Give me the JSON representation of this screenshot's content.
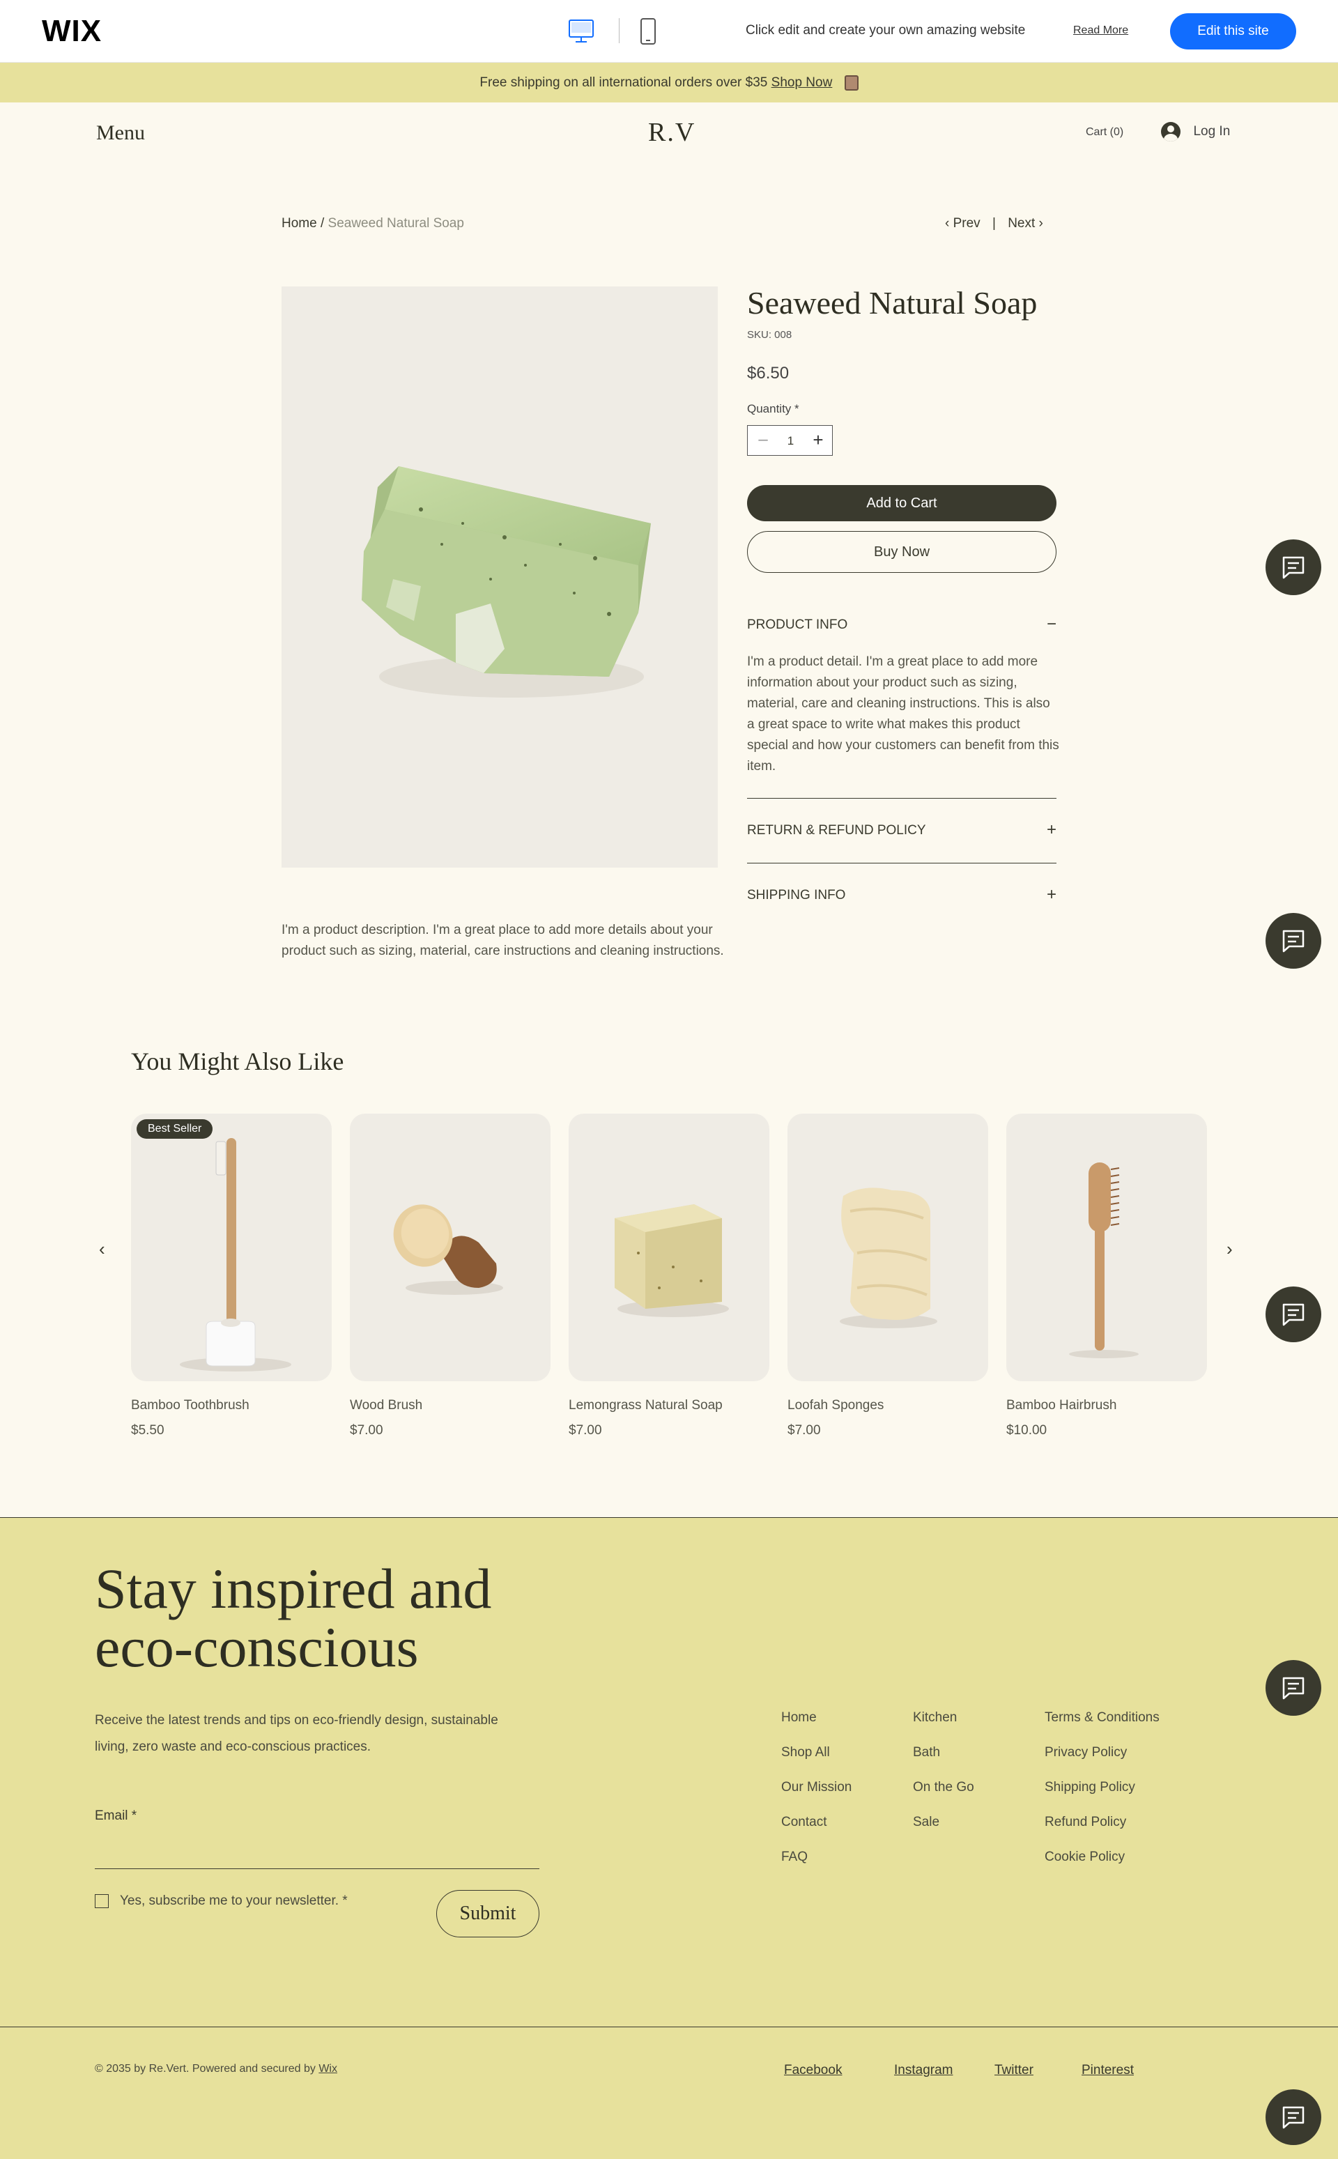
{
  "wix_bar": {
    "logo": "WIX",
    "promo_text": "Click edit and create your own amazing website",
    "read_more": "Read More",
    "edit_button": "Edit this site",
    "accent_color": "#116dff"
  },
  "announcement": {
    "text": "Free shipping on all international orders over $35",
    "link": "Shop Now",
    "icon": "shopping-bag-icon"
  },
  "header": {
    "menu": "Menu",
    "logo": "R.V",
    "cart": "Cart (0)",
    "login": "Log In"
  },
  "breadcrumb": {
    "home": "Home",
    "separator": " / ",
    "current": "Seaweed Natural Soap",
    "prev": "Prev",
    "divider": "|",
    "next": "Next"
  },
  "product": {
    "title": "Seaweed Natural Soap",
    "sku": "SKU: 008",
    "price": "$6.50",
    "quantity_label": "Quantity *",
    "quantity_value": "1",
    "add_to_cart": "Add to Cart",
    "buy_now": "Buy Now",
    "description": "I'm a product description. I'm a great place to add more details about your product such as sizing, material, care instructions and cleaning instructions.",
    "accordion": [
      {
        "title": "PRODUCT INFO",
        "toggle": "−",
        "body": "I'm a product detail. I'm a great place to add more information about your product such as sizing, material, care and cleaning instructions. This is also a great space to write what makes this product special and how your customers can benefit from this item."
      },
      {
        "title": "RETURN & REFUND POLICY",
        "toggle": "+"
      },
      {
        "title": "SHIPPING INFO",
        "toggle": "+"
      }
    ]
  },
  "related": {
    "title": "You Might Also Like",
    "badge": "Best Seller",
    "items": [
      {
        "name": "Bamboo Toothbrush",
        "price": "$5.50"
      },
      {
        "name": "Wood Brush",
        "price": "$7.00"
      },
      {
        "name": "Lemongrass Natural Soap",
        "price": "$7.00"
      },
      {
        "name": "Loofah Sponges",
        "price": "$7.00"
      },
      {
        "name": "Bamboo Hairbrush",
        "price": "$10.00"
      }
    ]
  },
  "footer": {
    "headline_1": "Stay inspired and",
    "headline_2": "eco-conscious",
    "text": "Receive the latest trends and tips on eco-friendly design, sustainable living, zero waste and eco-conscious practices.",
    "email_label": "Email *",
    "subscribe_label": "Yes, subscribe me to your newsletter. *",
    "submit": "Submit",
    "links_col1": [
      "Home",
      "Shop All",
      "Our Mission",
      "Contact",
      "FAQ"
    ],
    "links_col2": [
      "Kitchen",
      "Bath",
      "On the Go",
      "Sale"
    ],
    "links_col3": [
      "Terms & Conditions",
      "Privacy Policy",
      "Shipping Policy",
      "Refund Policy",
      "Cookie Policy"
    ],
    "copyright": "© 2035 by Re.Vert. Powered and secured by",
    "copyright_link": "Wix",
    "social": [
      "Facebook",
      "Instagram",
      "Twitter",
      "Pinterest"
    ]
  },
  "colors": {
    "page_bg": "#fcf9ef",
    "olive_dark": "#3a3a2e",
    "banner_yellow": "#e7e19c",
    "image_bg": "#efece5"
  }
}
